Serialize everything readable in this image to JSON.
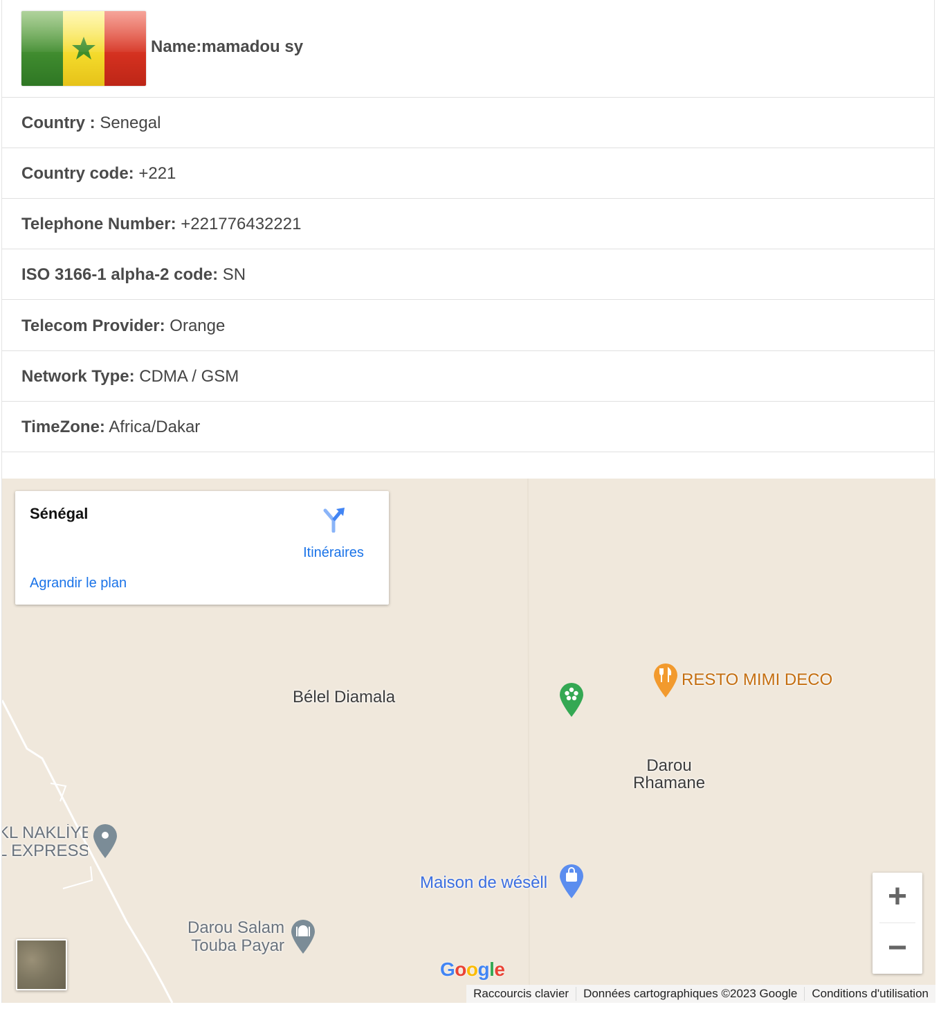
{
  "profile": {
    "name": "Name:mamadou sy",
    "flag_colors": [
      "#3e8a2e",
      "#f3d92a",
      "#d3301f"
    ]
  },
  "details": [
    {
      "label": "Country :",
      "value": " Senegal"
    },
    {
      "label": "Country code:",
      "value": " +221"
    },
    {
      "label": "Telephone Number:",
      "value": " +221776432221"
    },
    {
      "label": "ISO 3166-1 alpha-2 code:",
      "value": " SN"
    },
    {
      "label": "Telecom Provider:",
      "value": " Orange"
    },
    {
      "label": "Network Type:",
      "value": " CDMA / GSM"
    },
    {
      "label": "TimeZone:",
      "value": " Africa/Dakar"
    }
  ],
  "map": {
    "info_card": {
      "place_name": "Sénégal",
      "directions_label": "Itinéraires",
      "enlarge_label": "Agrandir le plan"
    },
    "labels": {
      "belel": "Bélel Diamala",
      "resto": "RESTO MIMI DECO",
      "darou_rhamane": [
        "Darou",
        "Rhamane"
      ],
      "nakliye": [
        "KL NAKLİYE",
        "L EXPRESS"
      ],
      "maison": "Maison de wésèll",
      "darou_salam": [
        "Darou Salam",
        "Touba Payar"
      ]
    },
    "google_logo": [
      "G",
      "o",
      "o",
      "g",
      "l",
      "e"
    ],
    "google_colors": [
      "#4285f4",
      "#ea4335",
      "#fbbc05",
      "#4285f4",
      "#34a853",
      "#ea4335"
    ],
    "zoom": {
      "in": "+",
      "out": "−"
    },
    "attribution": {
      "shortcuts": "Raccourcis clavier",
      "data": "Données cartographiques ©2023 Google",
      "terms": "Conditions d'utilisation"
    },
    "background_color": "#f0e8dc"
  }
}
